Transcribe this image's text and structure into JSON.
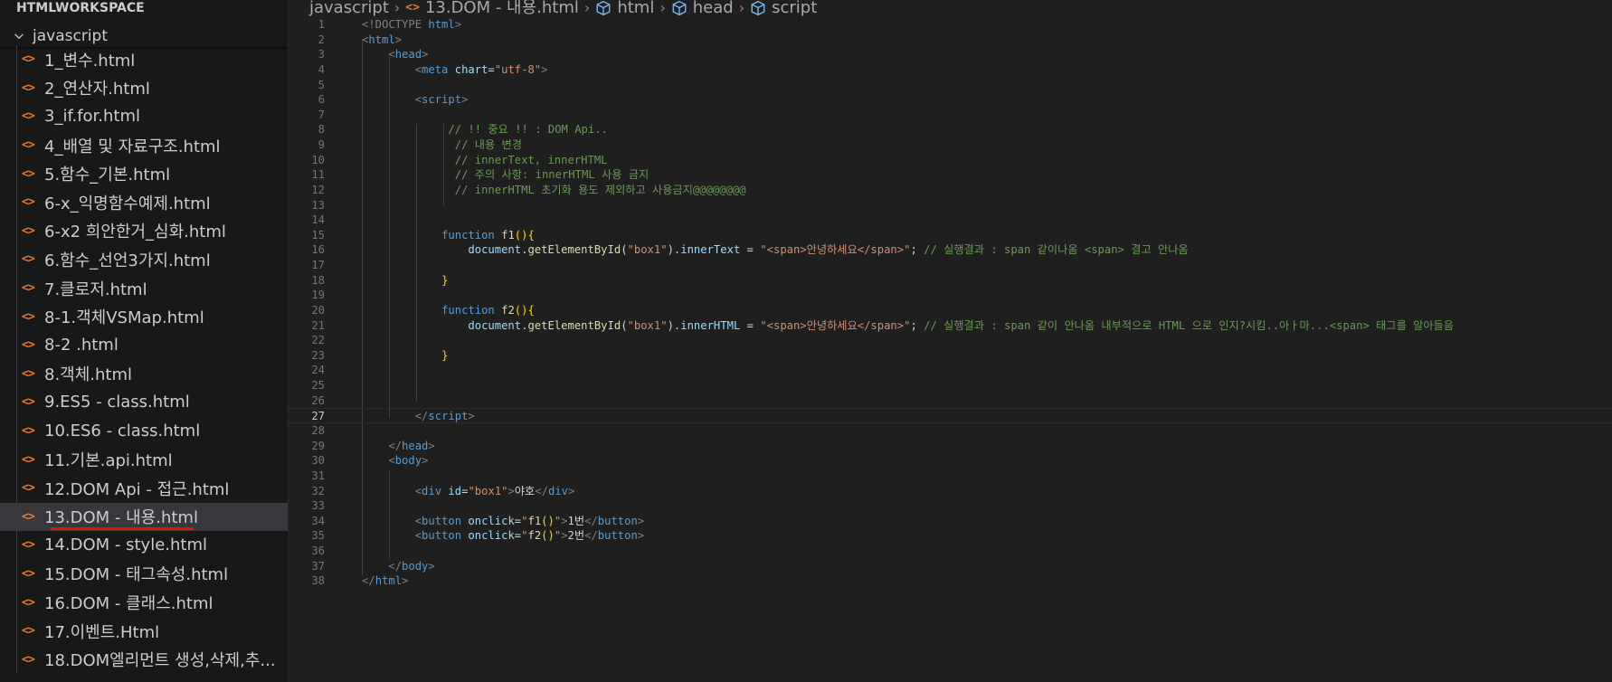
{
  "sidebar": {
    "workspace_title": "HTMLWORKSPACE",
    "folder": "javascript",
    "files": [
      "1_변수.html",
      "2_연산자.html",
      "3_if.for.html",
      "4_배열 및 자료구조.html",
      "5.함수_기본.html",
      "6-x_익명함수예제.html",
      "6-x2 희안한거_심화.html",
      "6.함수_선언3가지.html",
      "7.클로저.html",
      "8-1.객체VSMap.html",
      "8-2 .html",
      "8.객체.html",
      "9.ES5 - class.html",
      "10.ES6 - class.html",
      "11.기본.api.html",
      "12.DOM Api - 접근.html",
      "13.DOM - 내용.html",
      "14.DOM - style.html",
      "15.DOM - 태그속성.html",
      "16.DOM - 클래스.html",
      "17.이벤트.Html",
      "18.DOM엘리먼트 생성,삭제,추..."
    ],
    "active_index": 16
  },
  "breadcrumb": [
    "javascript",
    "13.DOM - 내용.html",
    "html",
    "head",
    "script"
  ],
  "editor": {
    "current_line": 27,
    "lines": [
      [
        [
          "<!DOCTYPE ",
          "tag"
        ],
        [
          "html",
          "tn"
        ],
        [
          ">",
          "tag"
        ]
      ],
      [
        [
          "<",
          "tag"
        ],
        [
          "html",
          "tn"
        ],
        [
          ">",
          "tag"
        ]
      ],
      [
        [
          "    ",
          "txt"
        ],
        [
          "<",
          "tag"
        ],
        [
          "head",
          "tn"
        ],
        [
          ">",
          "tag"
        ]
      ],
      [
        [
          "        ",
          "txt"
        ],
        [
          "<",
          "tag"
        ],
        [
          "meta ",
          "tn"
        ],
        [
          "chart",
          "at"
        ],
        [
          "=",
          "txt"
        ],
        [
          "\"utf-8\"",
          "str"
        ],
        [
          ">",
          "tag"
        ]
      ],
      [],
      [
        [
          "        ",
          "txt"
        ],
        [
          "<",
          "tag"
        ],
        [
          "script",
          "tn"
        ],
        [
          ">",
          "tag"
        ]
      ],
      [],
      [
        [
          "             ",
          "txt"
        ],
        [
          "// !! 중요 !! : DOM Api..",
          "com"
        ]
      ],
      [
        [
          "              ",
          "txt"
        ],
        [
          "// 내용 변경",
          "com"
        ]
      ],
      [
        [
          "              ",
          "txt"
        ],
        [
          "// innerText, innerHTML",
          "com"
        ]
      ],
      [
        [
          "              ",
          "txt"
        ],
        [
          "// 주의 사항: innerHTML 사용 금지",
          "com"
        ]
      ],
      [
        [
          "              ",
          "txt"
        ],
        [
          "// innerHTML 초기화 용도 제외하고 사용금지@@@@@@@@",
          "com"
        ]
      ],
      [],
      [],
      [
        [
          "            ",
          "txt"
        ],
        [
          "function ",
          "kw"
        ],
        [
          "f1",
          "fn"
        ],
        [
          "(){",
          "br"
        ]
      ],
      [
        [
          "                ",
          "txt"
        ],
        [
          "document",
          "var"
        ],
        [
          ".",
          "txt"
        ],
        [
          "getElementById",
          "fn"
        ],
        [
          "(",
          "txt"
        ],
        [
          "\"box1\"",
          "str"
        ],
        [
          ").",
          "txt"
        ],
        [
          "innerText",
          "var"
        ],
        [
          " = ",
          "txt"
        ],
        [
          "\"<span>안녕하세요</span>\"",
          "str"
        ],
        [
          "; ",
          "txt"
        ],
        [
          "// 실행결과 : span 같이나옴 <span> 결고 안나옴",
          "com"
        ]
      ],
      [],
      [
        [
          "            ",
          "txt"
        ],
        [
          "}",
          "br"
        ]
      ],
      [],
      [
        [
          "            ",
          "txt"
        ],
        [
          "function ",
          "kw"
        ],
        [
          "f2",
          "fn"
        ],
        [
          "(){",
          "br"
        ]
      ],
      [
        [
          "                ",
          "txt"
        ],
        [
          "document",
          "var"
        ],
        [
          ".",
          "txt"
        ],
        [
          "getElementById",
          "fn"
        ],
        [
          "(",
          "txt"
        ],
        [
          "\"box1\"",
          "str"
        ],
        [
          ").",
          "txt"
        ],
        [
          "innerHTML",
          "var"
        ],
        [
          " = ",
          "txt"
        ],
        [
          "\"<span>안녕하세요</span>\"",
          "str"
        ],
        [
          "; ",
          "txt"
        ],
        [
          "// 실행결과 : span 같이 안나옴 내부적으로 HTML 으로 인지?시킴..아ㅏ마...<span> 태그를 알아들음",
          "com"
        ]
      ],
      [],
      [
        [
          "            ",
          "txt"
        ],
        [
          "}",
          "br"
        ]
      ],
      [],
      [],
      [],
      [
        [
          "        ",
          "txt"
        ],
        [
          "</",
          "tag"
        ],
        [
          "script",
          "tn"
        ],
        [
          ">",
          "tag"
        ]
      ],
      [],
      [
        [
          "    ",
          "txt"
        ],
        [
          "</",
          "tag"
        ],
        [
          "head",
          "tn"
        ],
        [
          ">",
          "tag"
        ]
      ],
      [
        [
          "    ",
          "txt"
        ],
        [
          "<",
          "tag"
        ],
        [
          "body",
          "tn"
        ],
        [
          ">",
          "tag"
        ]
      ],
      [],
      [
        [
          "        ",
          "txt"
        ],
        [
          "<",
          "tag"
        ],
        [
          "div ",
          "tn"
        ],
        [
          "id",
          "at"
        ],
        [
          "=",
          "txt"
        ],
        [
          "\"box1\"",
          "str"
        ],
        [
          ">",
          "tag"
        ],
        [
          "야호",
          "txt"
        ],
        [
          "</",
          "tag"
        ],
        [
          "div",
          "tn"
        ],
        [
          ">",
          "tag"
        ]
      ],
      [],
      [
        [
          "        ",
          "txt"
        ],
        [
          "<",
          "tag"
        ],
        [
          "button ",
          "tn"
        ],
        [
          "onclick",
          "at"
        ],
        [
          "=",
          "txt"
        ],
        [
          "\"",
          "str"
        ],
        [
          "f1",
          "fn"
        ],
        [
          "()",
          "br"
        ],
        [
          "\"",
          "str"
        ],
        [
          ">",
          "tag"
        ],
        [
          "1번",
          "txt"
        ],
        [
          "</",
          "tag"
        ],
        [
          "button",
          "tn"
        ],
        [
          ">",
          "tag"
        ]
      ],
      [
        [
          "        ",
          "txt"
        ],
        [
          "<",
          "tag"
        ],
        [
          "button ",
          "tn"
        ],
        [
          "onclick",
          "at"
        ],
        [
          "=",
          "txt"
        ],
        [
          "\"",
          "str"
        ],
        [
          "f2",
          "fn"
        ],
        [
          "()",
          "br"
        ],
        [
          "\"",
          "str"
        ],
        [
          ">",
          "tag"
        ],
        [
          "2번",
          "txt"
        ],
        [
          "</",
          "tag"
        ],
        [
          "button",
          "tn"
        ],
        [
          ">",
          "tag"
        ]
      ],
      [],
      [
        [
          "    ",
          "txt"
        ],
        [
          "</",
          "tag"
        ],
        [
          "body",
          "tn"
        ],
        [
          ">",
          "tag"
        ]
      ],
      [
        [
          "</",
          "tag"
        ],
        [
          "html",
          "tn"
        ],
        [
          ">",
          "tag"
        ]
      ]
    ]
  },
  "colors": {
    "file_icon": "#e37933",
    "active_row": "#37373d",
    "underline": "#e51400",
    "comment": "#6a9955",
    "keyword": "#569cd6",
    "string": "#ce9178",
    "function": "#dcdcaa"
  },
  "icons": {
    "file": "html-file-icon",
    "breadcrumb_symbol": "cube-icon",
    "folder_toggle": "chevron-down-icon"
  }
}
